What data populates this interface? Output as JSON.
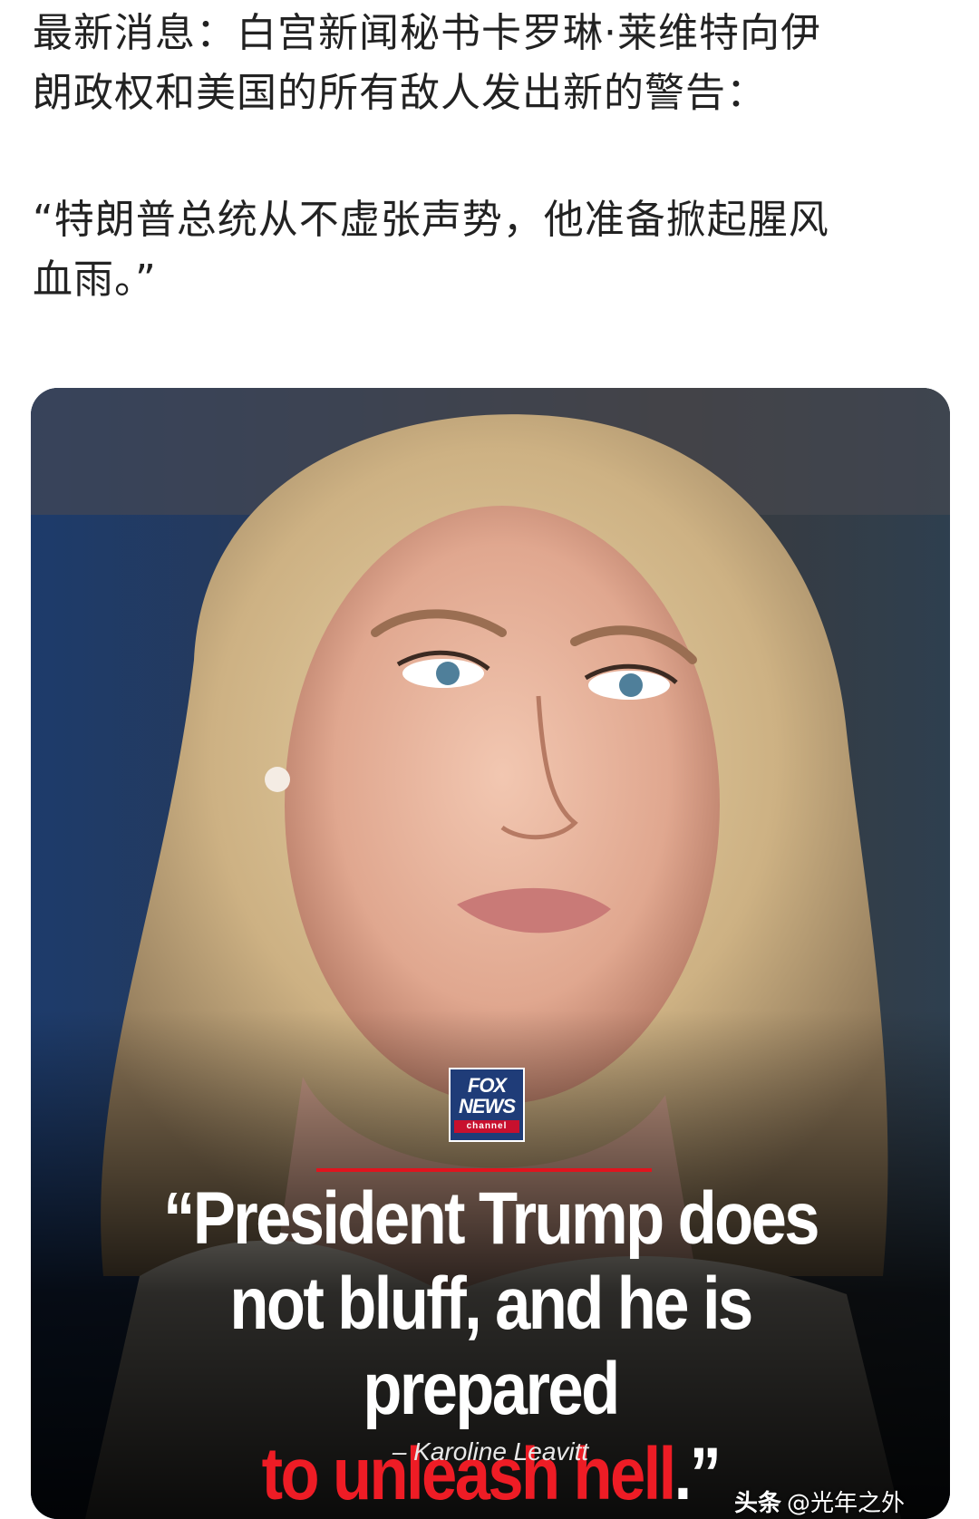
{
  "post": {
    "line1": "最新消息：白宫新闻秘书卡罗琳·莱维特向伊",
    "line2": "朗政权和美国的所有敌人发出新的警告：",
    "quote_line1": "“特朗普总统从不虚张声势，他准备掀起腥风",
    "quote_line2": "血雨。”"
  },
  "image": {
    "logo": {
      "line1": "FOX",
      "line2": "NEWS",
      "line3": "channel"
    },
    "quote_white": "“President Trump does not bluff, and he is prepared",
    "quote_red": "to unleash hell",
    "quote_end": ".”",
    "attribution": "– Karoline Leavitt",
    "colors": {
      "accent_red": "#ee1c25",
      "fox_blue": "#1f3c78"
    }
  },
  "watermark": {
    "brand": "头条",
    "handle": "@光年之外"
  }
}
